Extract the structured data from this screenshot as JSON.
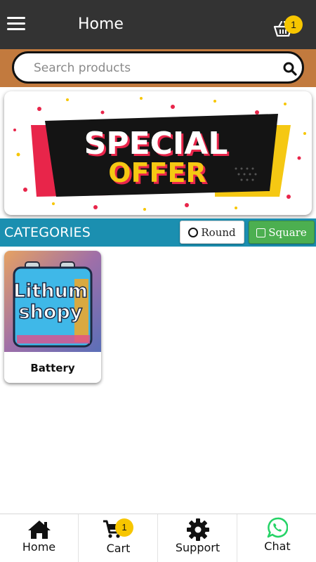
{
  "header": {
    "title": "Home",
    "menu_icon": "hamburger-menu-icon",
    "cart_icon": "basket-icon",
    "cart_count": "1"
  },
  "search": {
    "placeholder": "Search products",
    "icon": "search-icon"
  },
  "banner": {
    "line1": "SPECIAL",
    "line2": "OFFER"
  },
  "categories": {
    "title": "CATEGORIES",
    "round_label": "Round",
    "square_label": "Square",
    "items": [
      {
        "name": "Battery",
        "image_text_1": "Lithum",
        "image_text_2": "shopy"
      }
    ]
  },
  "bottom_nav": {
    "items": [
      {
        "label": "Home",
        "icon": "home-icon"
      },
      {
        "label": "Cart",
        "icon": "cart-icon",
        "badge": "1"
      },
      {
        "label": "Support",
        "icon": "gear-icon"
      },
      {
        "label": "Chat",
        "icon": "whatsapp-icon"
      }
    ]
  },
  "colors": {
    "appbar": "#333333",
    "search_strip": "#c27a3e",
    "categories_bar": "#1b8fb0",
    "square_button": "#4caf50",
    "badge": "#f7c600",
    "chat_icon": "#25d366"
  }
}
